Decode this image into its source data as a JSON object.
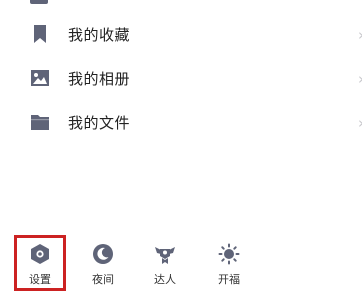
{
  "colors": {
    "icon": "#5f6478",
    "text": "#222222",
    "chevron": "#c8c8cc",
    "highlight": "#cc2222"
  },
  "menu": {
    "items": [
      {
        "label": "我的收藏",
        "icon": "bookmark-icon",
        "chevron": "›"
      },
      {
        "label": "我的相册",
        "icon": "photo-icon",
        "chevron": "›"
      },
      {
        "label": "我的文件",
        "icon": "folder-icon",
        "chevron": "›"
      }
    ]
  },
  "bottom_bar": {
    "actions": [
      {
        "label": "设置",
        "icon": "settings-icon",
        "highlighted": true
      },
      {
        "label": "夜间",
        "icon": "night-mode-icon"
      },
      {
        "label": "达人",
        "icon": "expert-icon"
      },
      {
        "label": "开福",
        "icon": "sun-icon"
      }
    ]
  }
}
